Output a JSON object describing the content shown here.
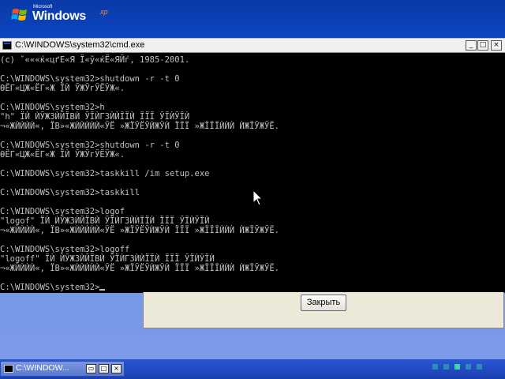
{
  "background": {
    "logo": {
      "microsoft": "Microsoft",
      "windows": "Windows",
      "xp": "xp"
    }
  },
  "cmd_window": {
    "title": "C:\\WINDOWS\\system32\\cmd.exe",
    "controls": {
      "minimize": "_",
      "maximize": "□",
      "close": "×"
    },
    "lines": [
      "(c) ˇ«««ќ«цґЕ«Я Ї«ў«ќЁ«ЯЙѓ, 1985-2001.",
      "",
      "C:\\WINDOWS\\system32>shutdown -r -t 0",
      "ѲЁГ«ЦЖ«ЁГ«Ж ЇЍ ЎЖЎгЎЁЎЖ«.",
      "",
      "C:\\WINDOWS\\system32>h",
      "\"h\" ЇЍ ЍЎЖЗЍЙЇВЍ ЎЇЍГЗЍЍЇЇЍ ЇЇЇ ЎЇЍЎЇЍ",
      "¬«ЖЍЍЍЍ«, ЇВ»«ЖЍЍЍЍЍ«ЎЁ »ЖЇЎЁЎЍЖЎЍ ЇЇЇ »ЖЇЇЇЍЍЍ ЍЖЇЎЖЎЁ.",
      "",
      "C:\\WINDOWS\\system32>shutdown -r -t 0",
      "ѲЁГ«ЦЖ«ЁГ«Ж ЇЍ ЎЖЎгЎЁЎЖ«.",
      "",
      "C:\\WINDOWS\\system32>taskkill /im setup.exe",
      "",
      "C:\\WINDOWS\\system32>taskkill",
      "",
      "C:\\WINDOWS\\system32>logof",
      "\"logof\" ЇЍ ЍЎЖЗЍЙЇВЍ ЎЇЍГЗЍЍЇЇЍ ЇЇЇ ЎЇЍЎЇЍ",
      "¬«ЖЍЍЍЍ«, ЇВ»«ЖЍЍЍЍЍ«ЎЁ »ЖЇЎЁЎЍЖЎЍ ЇЇЇ »ЖЇЇЇЍЍЍ ЍЖЇЎЖЎЁ.",
      "",
      "C:\\WINDOWS\\system32>logoff",
      "\"logoff\" ЇЍ ЍЎЖЗЍЙЇВЍ ЎЇЍГЗЍЍЇЇЍ ЇЇЇ ЎЇЍЎЇЍ",
      "¬«ЖЍЍЍЍ«, ЇВ»«ЖЍЍЍЍЍ«ЎЁ »ЖЇЎЁЎЍЖЎЍ ЇЇЇ »ЖЇЇЇЍЍЍ ЍЖЇЎЖЎЁ.",
      "",
      "C:\\WINDOWS\\system32>"
    ]
  },
  "setup_dialog": {
    "close_button": "Закрыть"
  },
  "taskbar": {
    "item_title": "C:\\WINDOW...",
    "controls": {
      "restore": "▭",
      "maximize": "□",
      "close": "×"
    },
    "progress": {
      "total_dots": 5,
      "active_dot": 2,
      "color": "#3fd4a4"
    }
  }
}
